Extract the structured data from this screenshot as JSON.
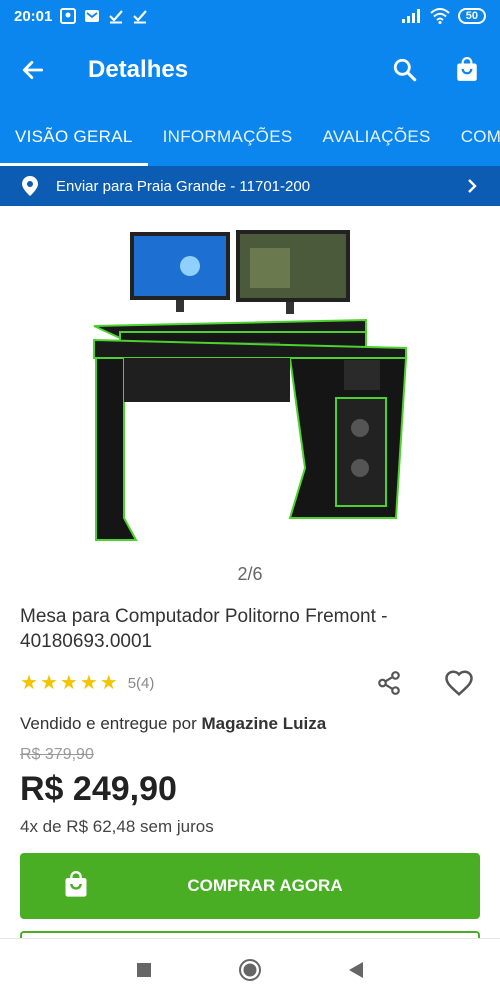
{
  "status_bar": {
    "time": "20:01",
    "battery": "50",
    "icons": [
      "gallery-icon",
      "mail-icon",
      "download-done-icon",
      "download-done-icon",
      "signal-icon",
      "wifi-icon",
      "battery-icon"
    ]
  },
  "app_bar": {
    "back_icon": "arrow-left-icon",
    "title": "Detalhes",
    "search_icon": "search-icon",
    "cart_icon": "shopping-bag-icon"
  },
  "tabs": [
    {
      "label": "VISÃO GERAL",
      "active": true
    },
    {
      "label": "INFORMAÇÕES",
      "active": false
    },
    {
      "label": "AVALIAÇÕES",
      "active": false
    },
    {
      "label": "COMP",
      "active": false
    }
  ],
  "shipping": {
    "text": "Enviar para Praia Grande - 11701-200",
    "icon": "location-pin-icon"
  },
  "gallery": {
    "pager": "2/6"
  },
  "product": {
    "title": "Mesa para Computador Politorno Fremont - 40180693.0001",
    "rating": 5,
    "rating_count": "5(4)",
    "seller_prefix": "Vendido e entregue por",
    "seller_name": "Magazine Luiza",
    "old_price": "R$ 379,90",
    "price": "R$ 249,90",
    "installments": "4x de R$ 62,48 sem juros"
  },
  "actions": {
    "buy_label": "COMPRAR AGORA"
  },
  "colors": {
    "primary": "#0b86ee",
    "shipping_bar": "#0d5cb4",
    "buy_button": "#4aae24",
    "star": "#f5c400"
  }
}
